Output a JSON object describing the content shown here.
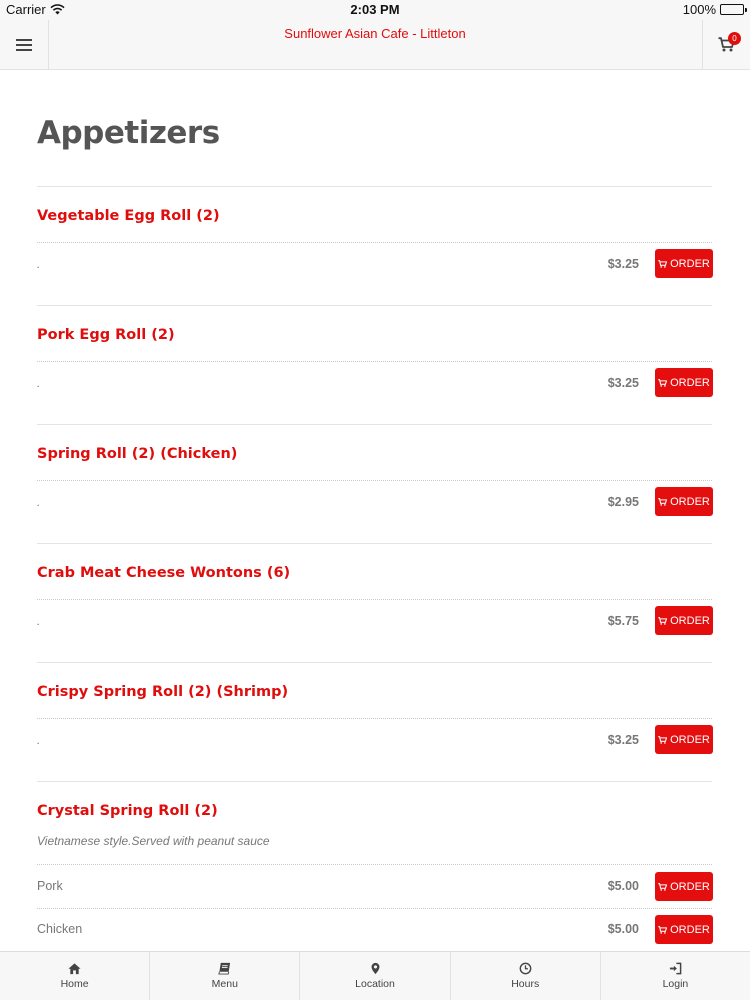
{
  "status_bar": {
    "carrier": "Carrier",
    "time": "2:03 PM",
    "battery": "100%"
  },
  "header": {
    "title": "Sunflower Asian Cafe - Littleton",
    "cart_count": "0"
  },
  "section": {
    "title": "Appetizers"
  },
  "order_label": "ORDER",
  "items": [
    {
      "name": "Vegetable Egg Roll (2)",
      "desc": ".",
      "price": "$3.25"
    },
    {
      "name": "Pork Egg Roll (2)",
      "desc": ".",
      "price": "$3.25"
    },
    {
      "name": "Spring Roll (2) (Chicken)",
      "desc": ".",
      "price": "$2.95"
    },
    {
      "name": "Crab Meat Cheese Wontons (6)",
      "desc": ".",
      "price": "$5.75"
    },
    {
      "name": "Crispy Spring Roll (2) (Shrimp)",
      "desc": ".",
      "price": "$3.25"
    },
    {
      "name": "Crystal Spring Roll (2)",
      "desc": "Vietnamese style.Served with peanut sauce",
      "options": [
        {
          "label": "Pork",
          "price": "$5.00"
        },
        {
          "label": "Chicken",
          "price": "$5.00"
        }
      ]
    }
  ],
  "nav": {
    "home": "Home",
    "menu": "Menu",
    "location": "Location",
    "hours": "Hours",
    "login": "Login"
  },
  "colors": {
    "accent": "#e00d0d",
    "button": "#e50e0e",
    "text": "#555555"
  }
}
